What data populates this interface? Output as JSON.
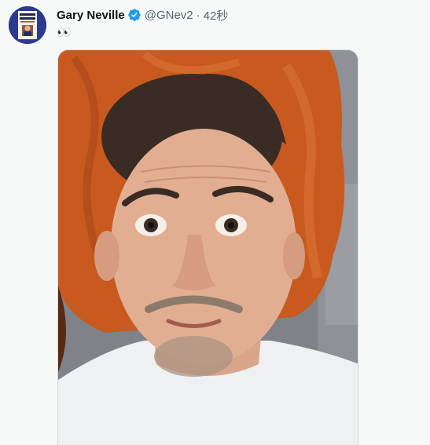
{
  "tweet": {
    "author": {
      "display_name": "Gary Neville",
      "handle": "@GNev2",
      "verified": true,
      "avatar_icon": "book-cover-avatar"
    },
    "separator": "·",
    "timestamp": "42秒",
    "text": "👀",
    "media": {
      "type": "photo"
    }
  },
  "colors": {
    "verified_badge": "#1d9bf0",
    "secondary_text": "#536471"
  }
}
